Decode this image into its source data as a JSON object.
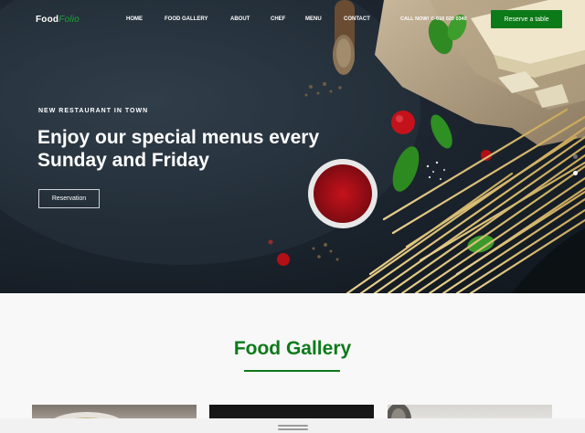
{
  "brand": {
    "name_part1": "Food",
    "name_part2": "Folio"
  },
  "nav": {
    "items": [
      {
        "label": "HOME"
      },
      {
        "label": "FOOD GALLERY"
      },
      {
        "label": "ABOUT"
      },
      {
        "label": "CHEF"
      },
      {
        "label": "MENU"
      },
      {
        "label": "CONTACT"
      }
    ],
    "phone": "CALL NOW! ✆ 010 020 0340",
    "cta_label": "Reserve a table"
  },
  "hero": {
    "tagline": "NEW RESTAURANT IN TOWN",
    "headline": "Enjoy our special menus every Sunday and Friday",
    "button_label": "Reservation"
  },
  "gallery": {
    "title": "Food Gallery"
  },
  "colors": {
    "accent": "#0d7a1a",
    "logo_accent": "#1ea83a"
  }
}
